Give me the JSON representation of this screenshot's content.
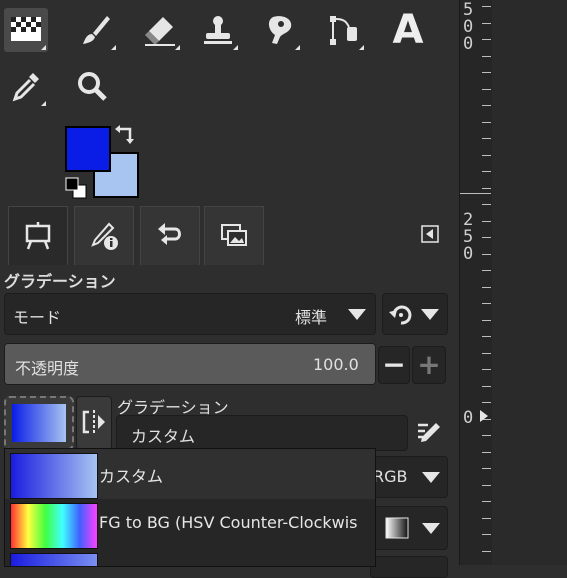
{
  "toolbox": {
    "tools": [
      {
        "name": "pattern-fill"
      },
      {
        "name": "paintbrush"
      },
      {
        "name": "eraser"
      },
      {
        "name": "clone-stamp"
      },
      {
        "name": "smudge"
      },
      {
        "name": "path"
      },
      {
        "name": "text",
        "glyph": "A"
      },
      {
        "name": "color-picker"
      },
      {
        "name": "zoom"
      }
    ]
  },
  "colors": {
    "foreground": "#0a1de6",
    "background": "#a8c4f0"
  },
  "tool_options": {
    "section_title": "グラデーション",
    "mode_label": "モード",
    "mode_value": "標準",
    "opacity_label": "不透明度",
    "opacity_value": "100.0",
    "opacity_fraction": 1.0,
    "minus_symbol": "−",
    "plus_symbol": "+",
    "gradient_label": "グラデーション",
    "gradient_value": "カスタム",
    "color_space_value": "RGB",
    "gradient_list": [
      {
        "label": "カスタム",
        "colors": [
          "#1a1de0",
          "#a8c4f0"
        ]
      },
      {
        "label": "FG to BG (HSV Counter-Clockwis",
        "colors": [
          "#ff3030",
          "#ffff40",
          "#40ff40",
          "#40ffff",
          "#4060ff",
          "#ff40ff"
        ]
      }
    ]
  },
  "ruler": {
    "labels": [
      {
        "digits": [
          "5",
          "0",
          "0"
        ]
      },
      {
        "digits": [
          "2",
          "5",
          "0"
        ]
      },
      {
        "digits": [
          "0"
        ]
      }
    ]
  }
}
